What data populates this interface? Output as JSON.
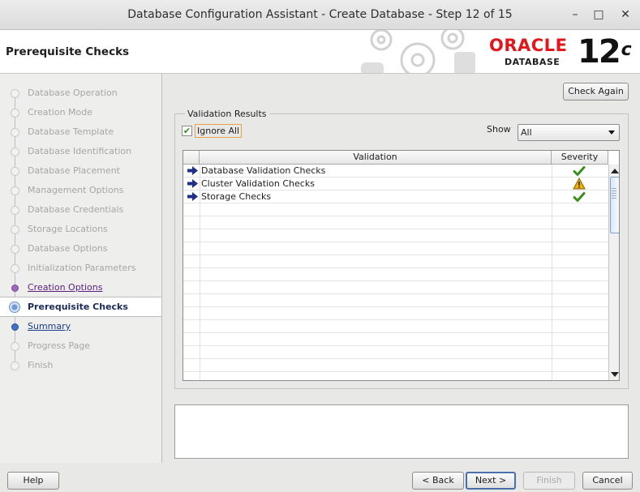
{
  "window": {
    "title": "Database Configuration Assistant - Create Database - Step 12 of 15",
    "minimize": "–",
    "maximize": "□",
    "close": "✕"
  },
  "header": {
    "page_title": "Prerequisite Checks",
    "brand": "ORACLE",
    "brand_sub": "DATABASE",
    "version": "12",
    "version_suffix": "c"
  },
  "nav": {
    "items": [
      {
        "label": "Database Operation",
        "state": "done"
      },
      {
        "label": "Creation Mode",
        "state": "done"
      },
      {
        "label": "Database Template",
        "state": "done"
      },
      {
        "label": "Database Identification",
        "state": "done"
      },
      {
        "label": "Database Placement",
        "state": "done"
      },
      {
        "label": "Management Options",
        "state": "done"
      },
      {
        "label": "Database Credentials",
        "state": "done"
      },
      {
        "label": "Storage Locations",
        "state": "done"
      },
      {
        "label": "Database Options",
        "state": "done"
      },
      {
        "label": "Initialization Parameters",
        "state": "done"
      },
      {
        "label": "Creation Options",
        "state": "link"
      },
      {
        "label": "Prerequisite Checks",
        "state": "active"
      },
      {
        "label": "Summary",
        "state": "next"
      },
      {
        "label": "Progress Page",
        "state": "future"
      },
      {
        "label": "Finish",
        "state": "future"
      }
    ]
  },
  "main": {
    "check_again_label": "Check Again",
    "group_title": "Validation Results",
    "ignore_all_label": "Ignore All",
    "ignore_all_checked": true,
    "show_label": "Show",
    "show_value": "All",
    "table": {
      "columns": [
        "Validation",
        "Severity"
      ],
      "rows": [
        {
          "name": "Database Validation Checks",
          "severity": "success"
        },
        {
          "name": "Cluster Validation Checks",
          "severity": "warning"
        },
        {
          "name": "Storage Checks",
          "severity": "success"
        }
      ]
    },
    "details_text": ""
  },
  "footer": {
    "help": "Help",
    "back": "< Back",
    "next": "Next >",
    "finish": "Finish",
    "cancel": "Cancel"
  },
  "colors": {
    "brand_red": "#e3161b",
    "success": "#3a8e19",
    "warning": "#f0b100",
    "arrow": "#1d2f86"
  }
}
